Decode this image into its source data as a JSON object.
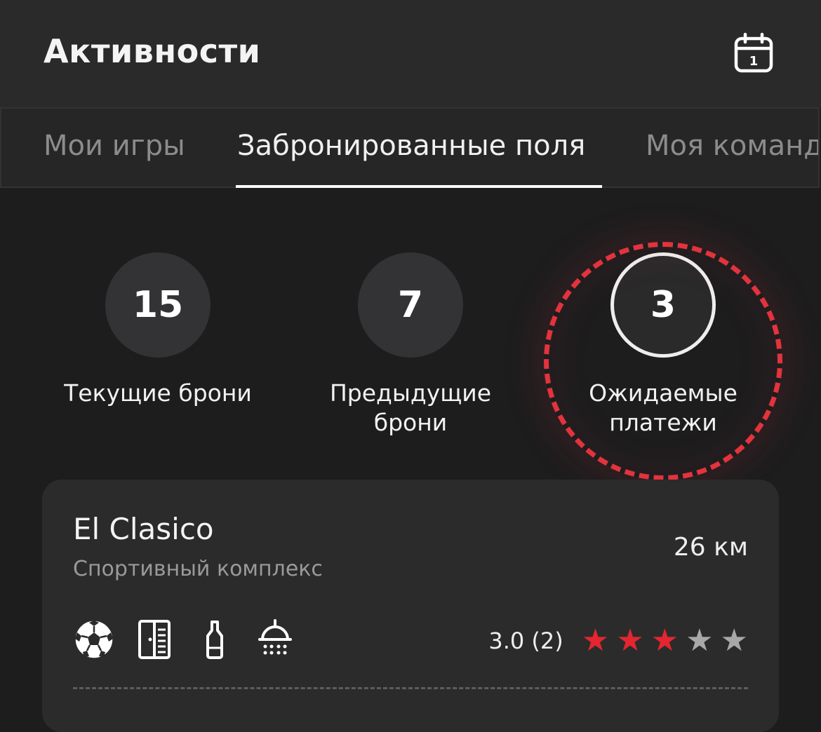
{
  "header": {
    "title": "Активности",
    "calendar_day": "1"
  },
  "tabs": [
    {
      "label": "Мои игры",
      "active": false
    },
    {
      "label": "Забронированные поля",
      "active": true
    },
    {
      "label": "Моя команда",
      "active": false
    }
  ],
  "stats": [
    {
      "value": "15",
      "label_line1": "Текущие брони",
      "label_line2": ""
    },
    {
      "value": "7",
      "label_line1": "Предыдущие",
      "label_line2": "брони"
    },
    {
      "value": "3",
      "label_line1": "Ожидаемые",
      "label_line2": "платежи",
      "selected": true
    }
  ],
  "card": {
    "name": "El Clasico",
    "type": "Спортивный комплекс",
    "distance": "26 км",
    "amenities": [
      "soccer-ball-icon",
      "locker-room-icon",
      "bottle-icon",
      "shower-icon"
    ],
    "rating_text": "3.0 (2)",
    "rating": 3,
    "rating_max": 5
  },
  "colors": {
    "accent": "#e3333d",
    "star_active": "#e3262f",
    "star_inactive": "#a8a8a8",
    "background": "#1d1d1e",
    "header_bg": "#2a2a2b"
  }
}
